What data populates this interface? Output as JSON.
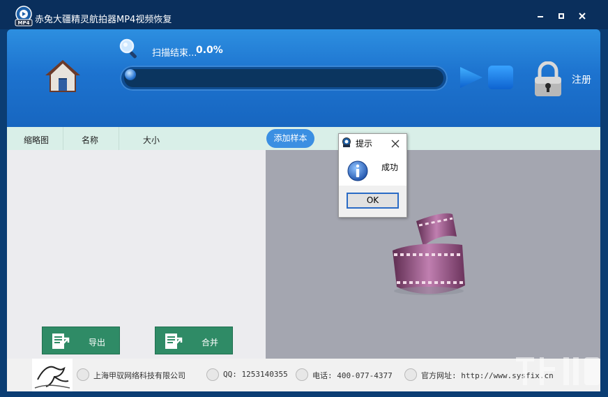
{
  "window": {
    "title": "赤兔大疆精灵航拍器MP4视频恢复",
    "logo_text": "MP4"
  },
  "scan": {
    "status": "扫描结束...",
    "percent": "0.0%",
    "progress": 0
  },
  "toolbar": {
    "register_label": "注册"
  },
  "columns": [
    "缩略图",
    "名称",
    "大小"
  ],
  "add_sample_label": "添加样本",
  "actions": {
    "export_label": "导出",
    "merge_label": "合并"
  },
  "dialog": {
    "title": "提示",
    "message": "成功",
    "ok_label": "OK"
  },
  "status_bar": {
    "company": "上海甲驭网络科技有限公司",
    "qq": "QQ: 1253140355",
    "phone": "电话: 400-077-4377",
    "website": "官方网址: http://www.sysfix.cn"
  },
  "colors": {
    "header_blue": "#1d73cf",
    "button_green": "#2f8b66",
    "add_sample_blue": "#3b8fe2",
    "preview_gray": "#a4a6b0"
  },
  "icons": [
    "home-icon",
    "search-icon",
    "play-icon",
    "stop-icon",
    "lock-icon",
    "info-icon",
    "film-reel-icon"
  ]
}
